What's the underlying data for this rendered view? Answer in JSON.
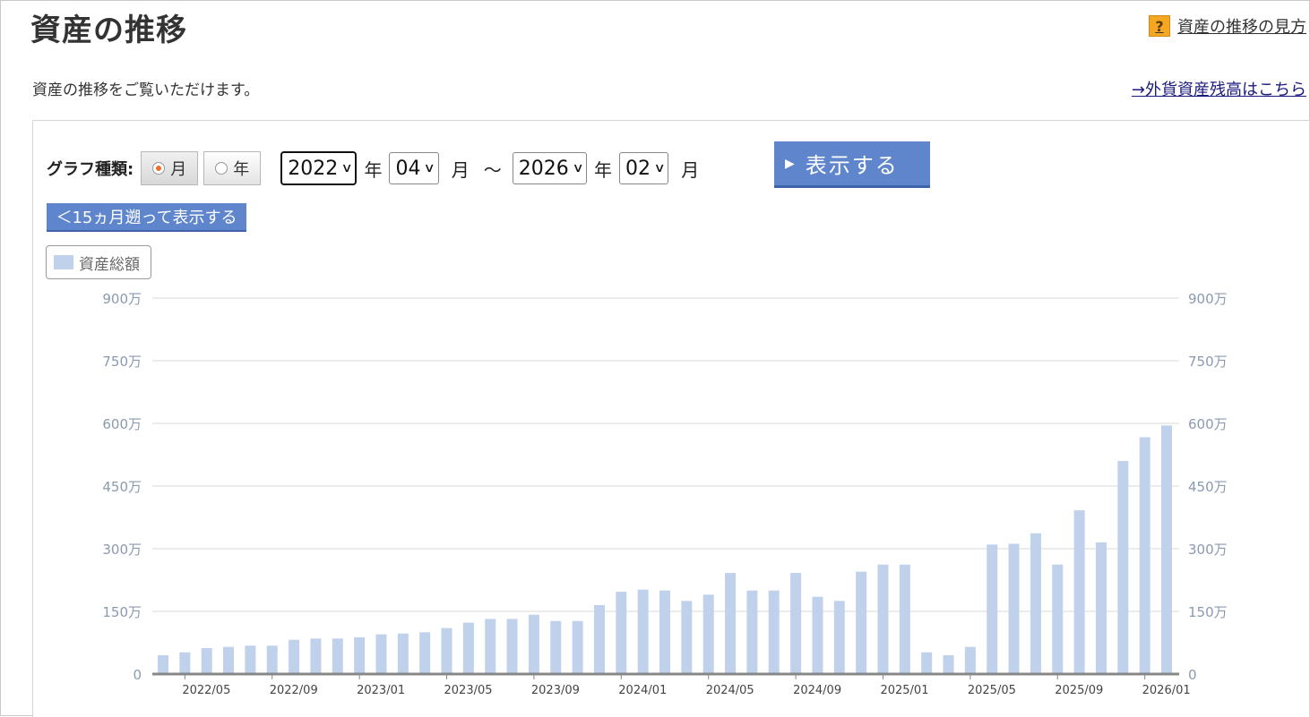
{
  "header": {
    "title": "資産の推移",
    "help_link": "資産の推移の見方",
    "help_icon_glyph": "?",
    "subtitle": "資産の推移をご覧いただけます。",
    "fx_link": "→外貨資産残高はこちら"
  },
  "controls": {
    "graph_type_label": "グラフ種類:",
    "radio_month": "月",
    "radio_year": "年",
    "selected_type": "月",
    "from_year": "2022",
    "from_month": "04",
    "to_year": "2026",
    "to_month": "02",
    "year_unit": "年",
    "month_unit": "月",
    "tilde": "～",
    "show_button": "表示する",
    "back_button": "＜15ヵ月遡って表示する"
  },
  "legend": {
    "label": "資産総額",
    "color": "#c0d1ec"
  },
  "chart_data": {
    "type": "bar",
    "title": "",
    "series": [
      {
        "name": "資産総額",
        "color": "#c0d1ec",
        "values": [
          45,
          52,
          62,
          65,
          68,
          68,
          82,
          85,
          85,
          88,
          95,
          97,
          100,
          110,
          123,
          132,
          132,
          142,
          127,
          127,
          165,
          197,
          202,
          200,
          175,
          190,
          242,
          200,
          200,
          242,
          185,
          175,
          245,
          262,
          262,
          52,
          45,
          65,
          310,
          312,
          337,
          262,
          392,
          315,
          510,
          567,
          595
        ]
      }
    ],
    "categories": [
      "2022/04",
      "2022/05",
      "2022/06",
      "2022/07",
      "2022/08",
      "2022/09",
      "2022/10",
      "2022/11",
      "2022/12",
      "2023/01",
      "2023/02",
      "2023/03",
      "2023/04",
      "2023/05",
      "2023/06",
      "2023/07",
      "2023/08",
      "2023/09",
      "2023/10",
      "2023/11",
      "2023/12",
      "2024/01",
      "2024/02",
      "2024/03",
      "2024/04",
      "2024/05",
      "2024/06",
      "2024/07",
      "2024/08",
      "2024/09",
      "2024/10",
      "2024/11",
      "2024/12",
      "2025/01",
      "2025/02",
      "2025/03",
      "2025/04",
      "2025/05",
      "2025/06",
      "2025/07",
      "2025/08",
      "2025/09",
      "2025/10",
      "2025/11",
      "2025/12",
      "2026/01",
      "2026/02"
    ],
    "x_tick_labels": [
      "2022/05",
      "2022/09",
      "2023/01",
      "2023/05",
      "2023/09",
      "2024/01",
      "2024/05",
      "2024/09",
      "2025/01",
      "2025/05",
      "2025/09",
      "2026/01"
    ],
    "x_tick_indices": [
      1,
      5,
      9,
      13,
      17,
      21,
      25,
      29,
      33,
      37,
      41,
      45
    ],
    "y_ticks": [
      0,
      150,
      300,
      450,
      600,
      750,
      900
    ],
    "y_tick_labels": [
      "0",
      "150万",
      "300万",
      "450万",
      "600万",
      "750万",
      "900万"
    ],
    "ylim": [
      0,
      900
    ],
    "unit": "万円",
    "grid": true,
    "xlabel": "",
    "ylabel": ""
  }
}
